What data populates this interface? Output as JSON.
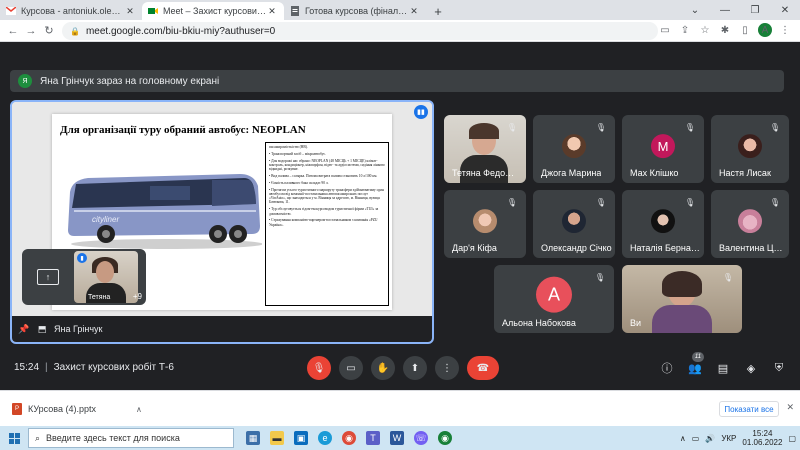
{
  "browser": {
    "tabs": [
      {
        "title": "Курсова - antoniuk.olena@vtec.",
        "icon": "gmail-icon",
        "active": false
      },
      {
        "title": "Meet – Захист курсових робі",
        "icon": "meet-icon",
        "active": true
      },
      {
        "title": "Готова курсова (фінальний вар",
        "icon": "page-icon",
        "active": false
      }
    ],
    "new_tab": "+",
    "url": "meet.google.com/biu-bkiu-miy?authuser=0",
    "profile_initial": "A"
  },
  "meet": {
    "banner_initial": "Я",
    "banner_text": "Яна Грінчук зараз на головному екрані",
    "presenter_name": "Яна Грінчук",
    "self_name": "Тетяна",
    "self_extra": "+9",
    "slide": {
      "title": "Для організації туру обраний автобус: NEOPLAN",
      "bullets": [
        "пасажиромісткістю (HB).",
        "• Транспортний засіб – мікроавтобус.",
        "• Для водорожі нас обрано: NEOPLAN (48 МІСЦЬ + 1 МІСЦЕ) клімат-контроль, кондиціонер, ніжпорфон, відео- та аудіосистеми, сидіння лінково відкидні, розкувне.",
        "• Вид палива – солярка. Питома витрата палива становить 10 л/100 км.",
        "• Ємність паливного бака складає 90 л.",
        "• Протягом усього туристичного маршруту трансфери здійснюватиму один автобусом від компанії-постачальника автопасажирських послуг «VinAuto», що знаходиться у м. Вінниця за адресою, м. Вінниця, вулиця Батюкова, 11.",
        "• Тур обслуговується гідом-екскурсоводом туристичної фірми «TUI» за домовленістю.",
        "• Страхування компанією-партнером-постачальником з компанія «PZU Україна»."
      ]
    },
    "participants": [
      {
        "name": "Тетяна Федосенко",
        "type": "video",
        "initial": ""
      },
      {
        "name": "Джога Марина",
        "type": "photo",
        "initial": ""
      },
      {
        "name": "Мах Клішко",
        "type": "letter",
        "initial": "M"
      },
      {
        "name": "Настя Лисак",
        "type": "photo",
        "initial": ""
      },
      {
        "name": "Дар'я Кіфа",
        "type": "photo",
        "initial": ""
      },
      {
        "name": "Олександр Січко",
        "type": "photo",
        "initial": ""
      },
      {
        "name": "Наталія Бернадська",
        "type": "photo",
        "initial": ""
      },
      {
        "name": "Валентина Цимбалюк",
        "type": "photo",
        "initial": ""
      },
      {
        "name": "Альона Набокова",
        "type": "letter",
        "initial": "A"
      },
      {
        "name": "Ви",
        "type": "video",
        "initial": ""
      }
    ],
    "time": "15:24",
    "meeting_title": "Захист курсових робіт Т-6",
    "people_count": "11",
    "colors": {
      "accent": "#8ab4f8",
      "hangup": "#ea4335",
      "tile": "#3c4043"
    }
  },
  "download": {
    "file": "КУрсова (4).pptx",
    "show_all": "Показати все"
  },
  "taskbar": {
    "search_placeholder": "Введите здесь текст для поиска",
    "lang": "УКР",
    "time": "15:24",
    "date": "01.06.2022"
  }
}
